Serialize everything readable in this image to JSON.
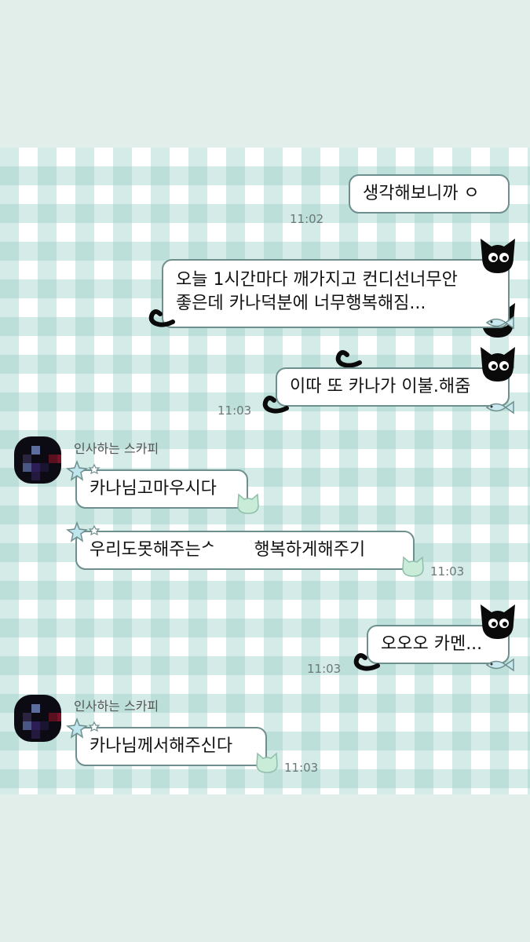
{
  "colors": {
    "background": "#e1eeea",
    "gingham": "#96cdc3",
    "bubble_border": "#6f8f8f",
    "time_text": "#6b7878"
  },
  "messages": {
    "m1": {
      "text": "생각해보니까 ㅇ",
      "time": "11:02"
    },
    "m2": {
      "line1": "오늘 1시간마다 깨가지고 컨디선너무안",
      "line2": "좋은데 카나덕분에 너무행복해짐..."
    },
    "m3": {
      "text": "이따 또 카나가 이불.해줌",
      "time": "11:03"
    },
    "g1": {
      "sender": "인사하는 스카피",
      "msg1": "카나님고마우시다",
      "msg2": "우리도못해주는ᄼ  ᆢ이행복하게해주기",
      "time": "11:03"
    },
    "m4": {
      "text": "오오오 카멘...",
      "time": "11:03"
    },
    "g2": {
      "sender": "인사하는 스카피",
      "msg1": "카나님께서해주신다",
      "time": "11:03"
    }
  },
  "icons": {
    "sender_decoration": "black-cat-peek-icon",
    "sender_tail": "cat-tail-icon",
    "sender_fish": "fish-icon",
    "receiver_star": "star-icon",
    "receiver_cat": "mint-cat-icon"
  }
}
